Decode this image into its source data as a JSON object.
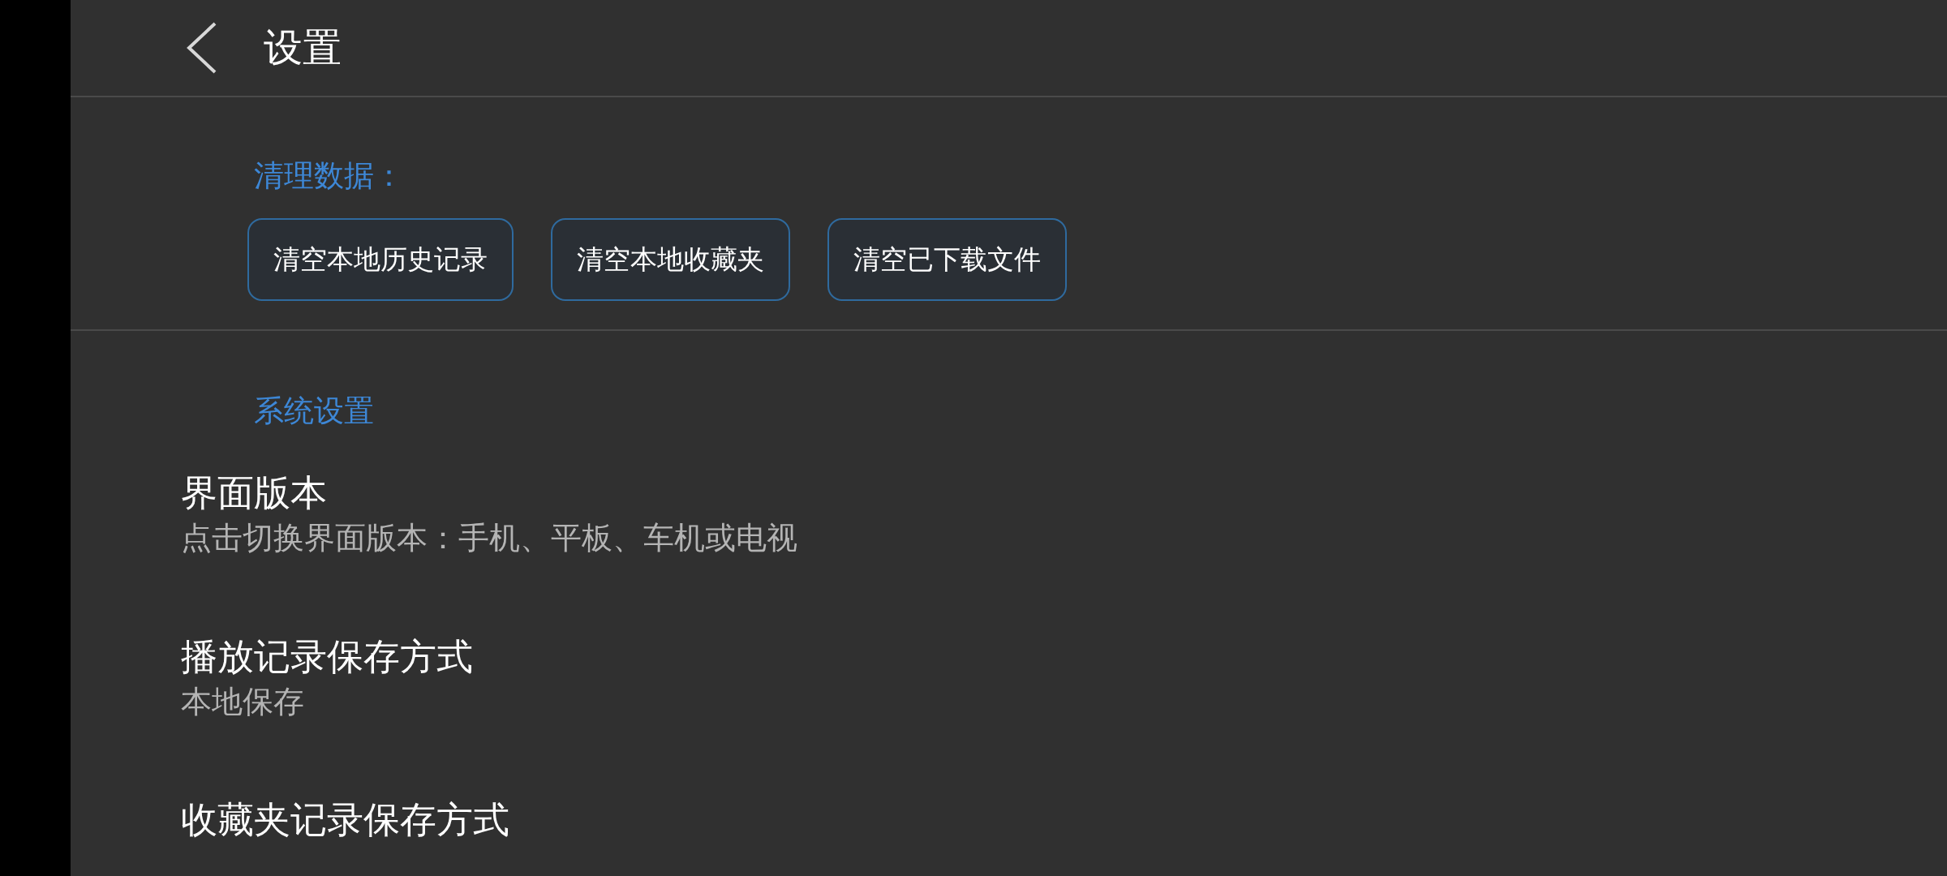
{
  "header": {
    "title": "设置"
  },
  "clear_section": {
    "heading": "清理数据：",
    "buttons": [
      "清空本地历史记录",
      "清空本地收藏夹",
      "清空已下载文件"
    ]
  },
  "system_section": {
    "heading": "系统设置",
    "items": [
      {
        "title": "界面版本",
        "subtitle": "点击切换界面版本：手机、平板、车机或电视"
      },
      {
        "title": "播放记录保存方式",
        "subtitle": "本地保存"
      },
      {
        "title": "收藏夹记录保存方式"
      }
    ]
  }
}
